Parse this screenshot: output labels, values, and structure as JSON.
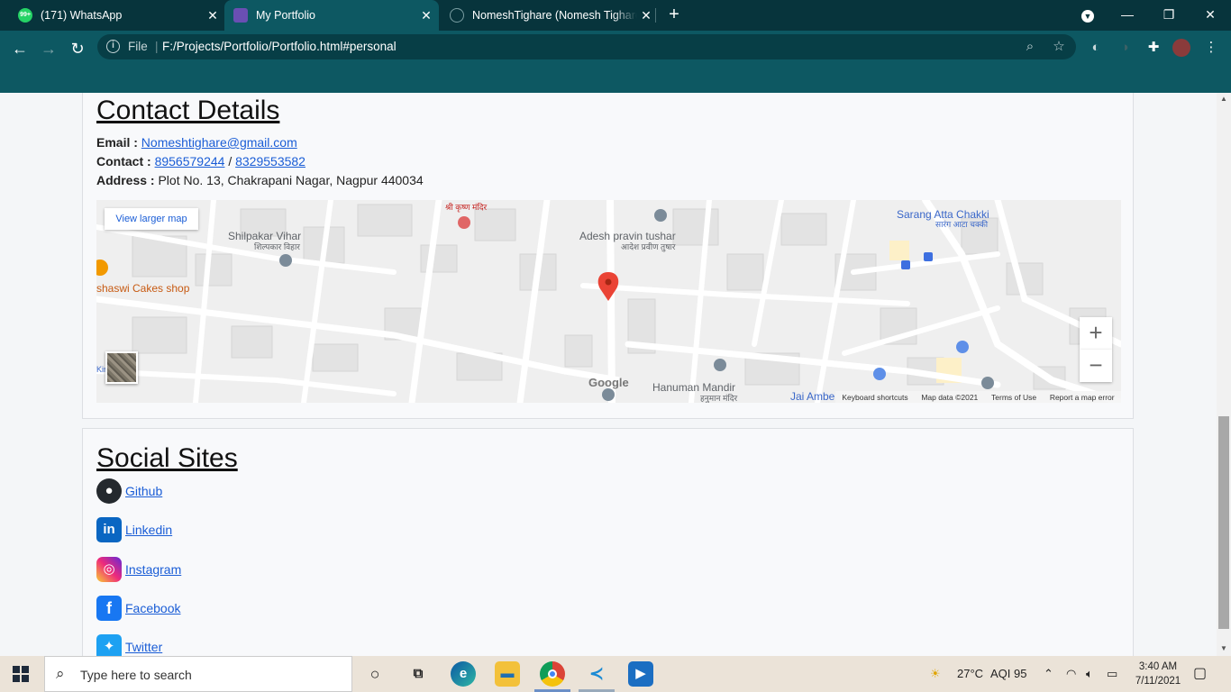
{
  "browser": {
    "tabs": [
      {
        "title": "(171) WhatsApp",
        "favicon": "whatsapp-icon",
        "badge": "99+",
        "active": false
      },
      {
        "title": "My Portfolio",
        "favicon": "portfolio-icon",
        "active": true
      },
      {
        "title": "NomeshTighare (Nomesh Tighare)",
        "favicon": "github-icon",
        "active": false
      }
    ],
    "new_tab": "+",
    "window_controls": {
      "minimize": "—",
      "maximize": "❐",
      "close": "✕"
    },
    "omnibox": {
      "scheme_label": "File",
      "separator": "|",
      "url": "F:/Projects/Portfolio/Portfolio.html#personal"
    }
  },
  "contact": {
    "heading": "Contact Details",
    "email_label": "Email :",
    "email": "Nomeshtighare@gmail.com",
    "contact_label": "Contact :",
    "phone1": "8956579244",
    "phone_sep": "/",
    "phone2": "8329553582",
    "address_label": "Address :",
    "address": "Plot No. 13, Chakrapani Nagar, Nagpur 440034"
  },
  "map": {
    "view_larger": "View larger map",
    "labels": {
      "shilpakar": "Shilpakar Vihar",
      "shilpakar_hi": "शिल्पकार विहार",
      "krishna_mandir_hi": "श्री कृष्ण मंदिर",
      "adesh": "Adesh pravin tushar",
      "adesh_hi": "आदेश प्रवीण तुषार",
      "sarang": "Sarang Atta Chakki",
      "sarang_hi": "सारंग आटा चक्की",
      "cakes": "shaswi Cakes shop",
      "hanuman": "Hanuman Mandir",
      "hanuman_hi": "हनुमान मंदिर",
      "jai": "Jai Ambe",
      "left_cut": "Kir",
      "google": "Google"
    },
    "zoom_in": "+",
    "zoom_out": "−",
    "footer": {
      "shortcuts": "Keyboard shortcuts",
      "mapdata": "Map data ©2021",
      "terms": "Terms of Use",
      "report": "Report a map error"
    }
  },
  "social": {
    "heading": "Social Sites",
    "items": [
      {
        "label": "Github",
        "icon": "github-icon",
        "color": "#24292e"
      },
      {
        "label": "Linkedin",
        "icon": "linkedin-icon",
        "color": "#0a66c2"
      },
      {
        "label": "Instagram",
        "icon": "instagram-icon",
        "color": "#d6249f"
      },
      {
        "label": "Facebook",
        "icon": "facebook-icon",
        "color": "#1877f2"
      },
      {
        "label": "Twitter",
        "icon": "twitter-icon",
        "color": "#1da1f2"
      }
    ]
  },
  "taskbar": {
    "search_placeholder": "Type here to search",
    "weather": "27°C",
    "aqi": "AQI 95",
    "time": "3:40 AM",
    "date": "7/11/2021"
  },
  "colors": {
    "chrome_dark": "#07343c",
    "chrome": "#0d5862",
    "link": "#1a5dd6",
    "map_pin": "#ea4335"
  }
}
